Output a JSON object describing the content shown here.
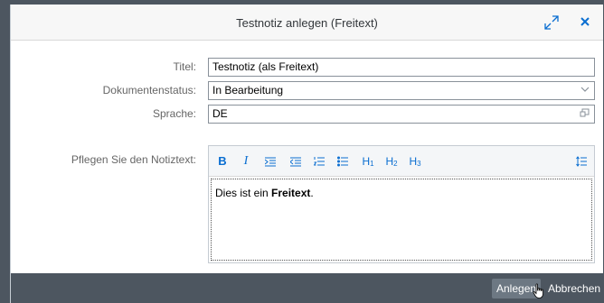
{
  "dialog": {
    "title": "Testnotiz anlegen (Freitext)",
    "icons": {
      "expand": "expand-icon",
      "close": "close-icon"
    }
  },
  "form": {
    "title_label": "Titel:",
    "title_value": "Testnotiz (als Freitext)",
    "status_label": "Dokumentenstatus:",
    "status_value": "In Bearbeitung",
    "language_label": "Sprache:",
    "language_value": "DE",
    "note_label": "Pflegen Sie den Notiztext:"
  },
  "editor": {
    "toolbar": {
      "bold": "B",
      "italic": "I",
      "h1": "H",
      "h2": "H",
      "h3": "H",
      "h1_sub": "1",
      "h2_sub": "2",
      "h3_sub": "3"
    },
    "content_prefix": "Dies ist ein ",
    "content_bold": "Freitext",
    "content_suffix": "."
  },
  "footer": {
    "create_label": "Anlegen",
    "cancel_label": "Abbrechen"
  },
  "colors": {
    "accent": "#0a6ed1",
    "footer_bg": "#4d5660"
  }
}
